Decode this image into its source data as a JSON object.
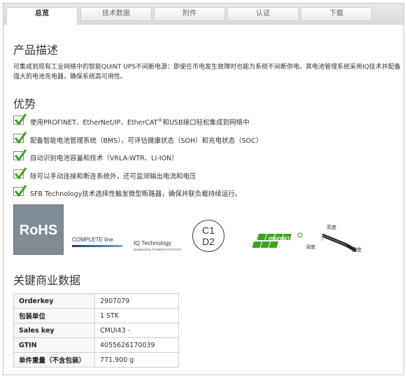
{
  "tabs": [
    {
      "label": "总览",
      "active": true
    },
    {
      "label": "技术数据",
      "active": false
    },
    {
      "label": "附件",
      "active": false
    },
    {
      "label": "认证",
      "active": false
    },
    {
      "label": "下载",
      "active": false
    }
  ],
  "description": {
    "heading": "产品描述",
    "text": "可集成到现有工业网络中的智能QUINT UPS不间断电源：即使在市电发生故障时也能为系统不间断供电。其电池管理系统采用IQ技术并配备强大的电池充电器，确保系统高可用性。"
  },
  "advantages": {
    "heading": "优势",
    "items": [
      {
        "text": "使用PROFINET、EtherNet/IP、EtherCAT",
        "sup": "®",
        "text_after": "和USB接口轻松集成到网络中"
      },
      {
        "text": "配备智能电池管理系统（BMS），可评估健康状态（SOH）和充电状态（SOC）",
        "sup": "",
        "text_after": ""
      },
      {
        "text": "自动识别电池容量和技术（VRLA-WTR、LI-ION）",
        "sup": "",
        "text_after": ""
      },
      {
        "text": "除可以手动连接和断连系统外，还可监测输出电流和电压",
        "sup": "",
        "text_after": ""
      },
      {
        "text": "SFB Technology技术选择性触发微型断路器，确保并联负载持续运行。",
        "sup": "",
        "text_after": ""
      }
    ]
  },
  "logos": {
    "rohs": "RoHS",
    "complete_line": "COMPLETE line",
    "iq_technology": "IQ Technology",
    "iq_sub": "Designed by PHOENIX CONTACT",
    "c1": "C1",
    "d2": "D2",
    "profinet": "PROFINET",
    "dim_height": "高度",
    "dim_depth": "深度",
    "dim_width": "宽度"
  },
  "commercial": {
    "heading": "关键商业数据",
    "rows": [
      {
        "key": "Orderkey",
        "value": "2907079"
      },
      {
        "key": "包装单位",
        "value": "1 STK"
      },
      {
        "key": "Sales key",
        "value": "CMUI43 -"
      },
      {
        "key": "GTIN",
        "value": "4055626170039"
      },
      {
        "key": "单件重量（不含包装）",
        "value": "771.900 g"
      }
    ]
  },
  "colors": {
    "check_green": "#3aa520",
    "rohs_bg": "#7f8b95",
    "profinet_green": "#3aa520"
  }
}
